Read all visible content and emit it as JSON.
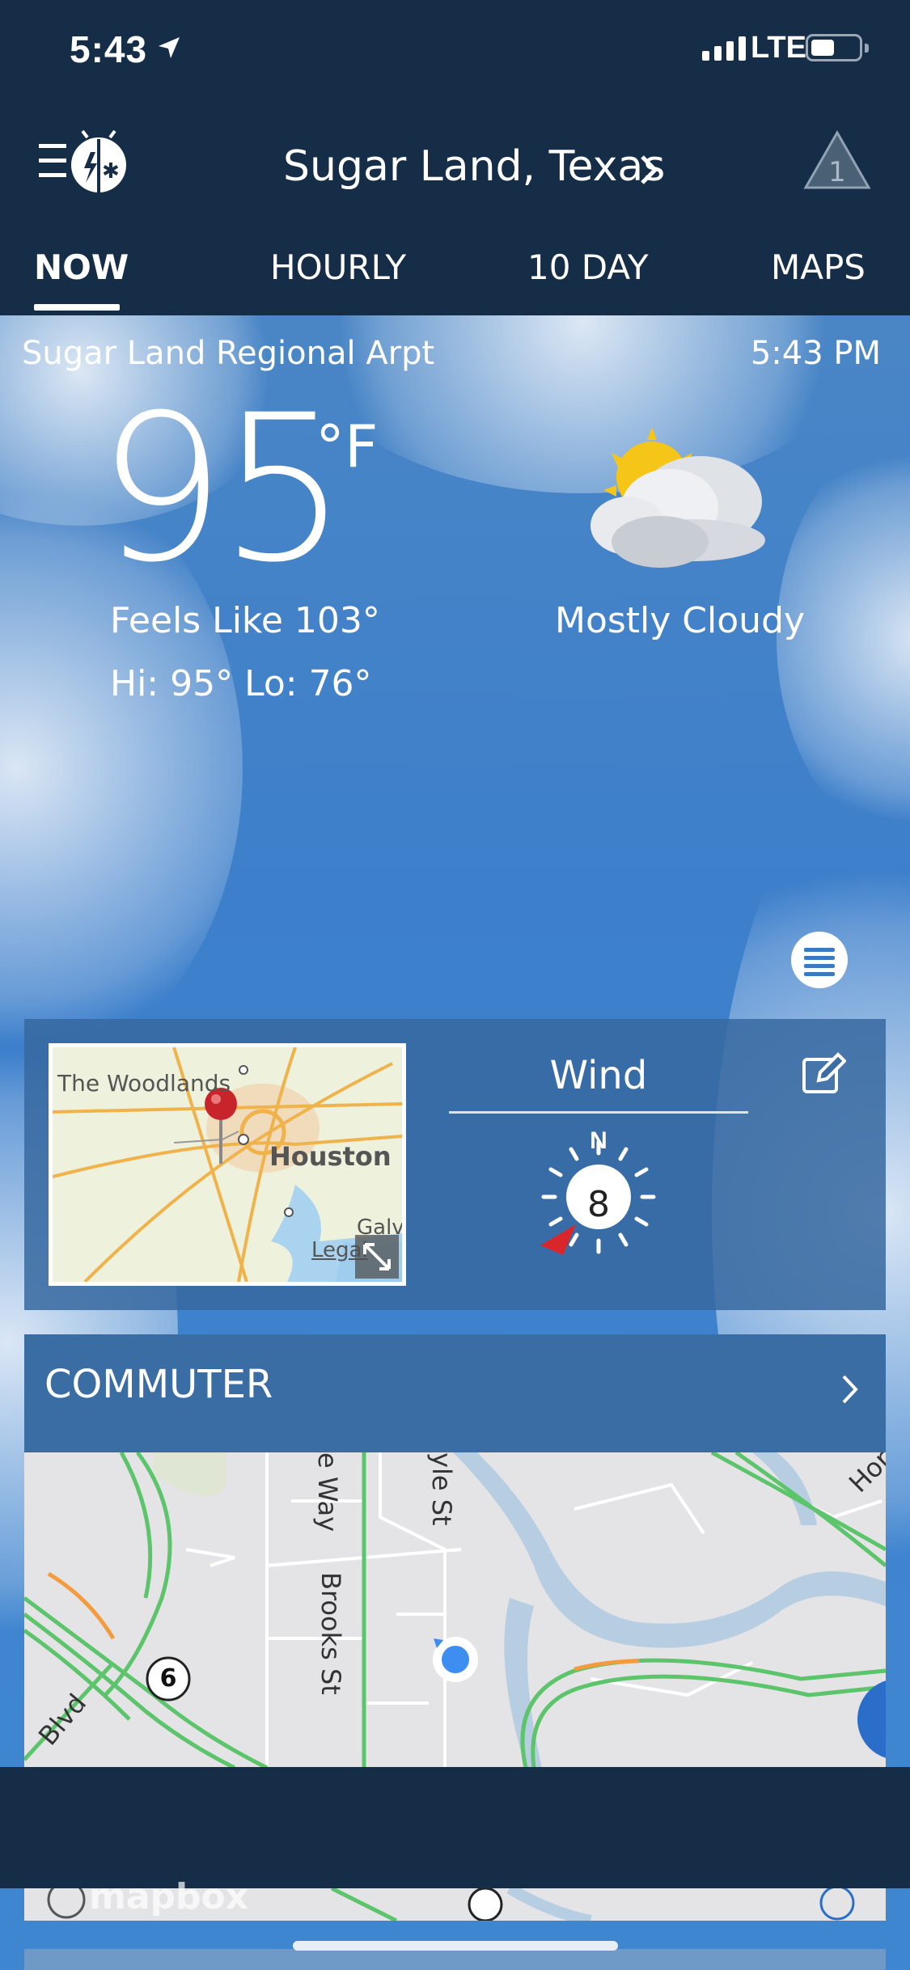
{
  "status_bar": {
    "time": "5:43",
    "network": "LTE"
  },
  "header": {
    "location": "Sugar Land, Texas",
    "alert_count": "1"
  },
  "tabs": [
    {
      "label": "NOW",
      "active": true
    },
    {
      "label": "HOURLY",
      "active": false
    },
    {
      "label": "10 DAY",
      "active": false
    },
    {
      "label": "MAPS",
      "active": false
    }
  ],
  "current": {
    "station": "Sugar Land Regional Arpt",
    "time": "5:43 PM",
    "temperature": "95",
    "unit": "°F",
    "feels_like": "Feels Like 103°",
    "hi_lo": "Hi: 95° Lo: 76°",
    "condition": "Mostly Cloudy",
    "icon": "mostly-cloudy-icon"
  },
  "map_card": {
    "labels": {
      "woodlands": "The Woodlands",
      "houston": "Houston",
      "galveston": "Galv",
      "legal": "Legal"
    }
  },
  "wind": {
    "title": "Wind",
    "direction_label": "N",
    "speed": "8"
  },
  "commuter": {
    "title": "COMMUTER",
    "road_labels": {
      "brooks": "Brooks St",
      "way": "e Way",
      "yle": "yle St",
      "blvd": "Blvd",
      "hor": "Hor",
      "route": "6"
    },
    "attribution": "mapbox"
  },
  "colors": {
    "header_bg": "#162d47",
    "sky": "#3f86d0",
    "card": "#3a6da3",
    "pin": "#c8242b",
    "traffic_green": "#5cc46a"
  }
}
